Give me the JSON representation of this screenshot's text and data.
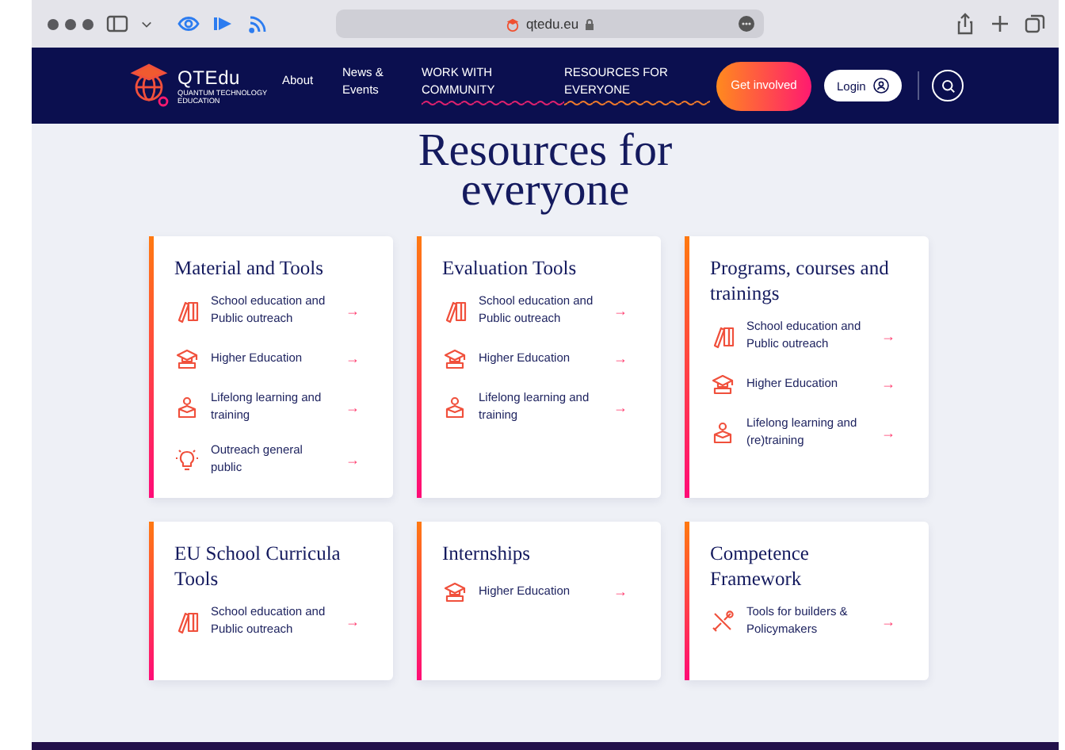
{
  "browser": {
    "address": "qtedu.eu"
  },
  "nav": {
    "logo_name": "QTEdu",
    "logo_tagline": "QUANTUM TECHNOLOGY EDUCATION",
    "links": [
      {
        "label": "About"
      },
      {
        "label": "News & Events"
      },
      {
        "label": "WORK WITH COMMUNITY",
        "color": "#e0206e"
      },
      {
        "label": "RESOURCES FOR EVERYONE",
        "color": "#f07a2a"
      }
    ],
    "cta": "Get involved",
    "login": "Login"
  },
  "heading": "Resources for everyone",
  "cards": [
    {
      "title": "Material and Tools",
      "items": [
        {
          "kind": "books",
          "label": "School education and Public outreach"
        },
        {
          "kind": "cap",
          "label": "Higher Education"
        },
        {
          "kind": "learner",
          "label": "Lifelong learning and training"
        },
        {
          "kind": "bulb",
          "label": "Outreach general public"
        }
      ]
    },
    {
      "title": "Evaluation Tools",
      "items": [
        {
          "kind": "books",
          "label": "School education and Public outreach"
        },
        {
          "kind": "cap",
          "label": "Higher Education"
        },
        {
          "kind": "learner",
          "label": "Lifelong learning and training"
        }
      ]
    },
    {
      "title": "Programs, courses and trainings",
      "items": [
        {
          "kind": "books",
          "label": "School education and Public outreach"
        },
        {
          "kind": "cap",
          "label": "Higher Education"
        },
        {
          "kind": "learner",
          "label": "Lifelong learning and (re)training"
        }
      ]
    },
    {
      "title": "EU School Curricula Tools",
      "items": [
        {
          "kind": "books",
          "label": "School education and Public outreach"
        }
      ]
    },
    {
      "title": "Internships",
      "items": [
        {
          "kind": "cap",
          "label": "Higher Education"
        }
      ]
    },
    {
      "title": "Competence Framework",
      "items": [
        {
          "kind": "tools",
          "label": "Tools for builders & Policymakers"
        }
      ]
    }
  ],
  "arrow": "→"
}
